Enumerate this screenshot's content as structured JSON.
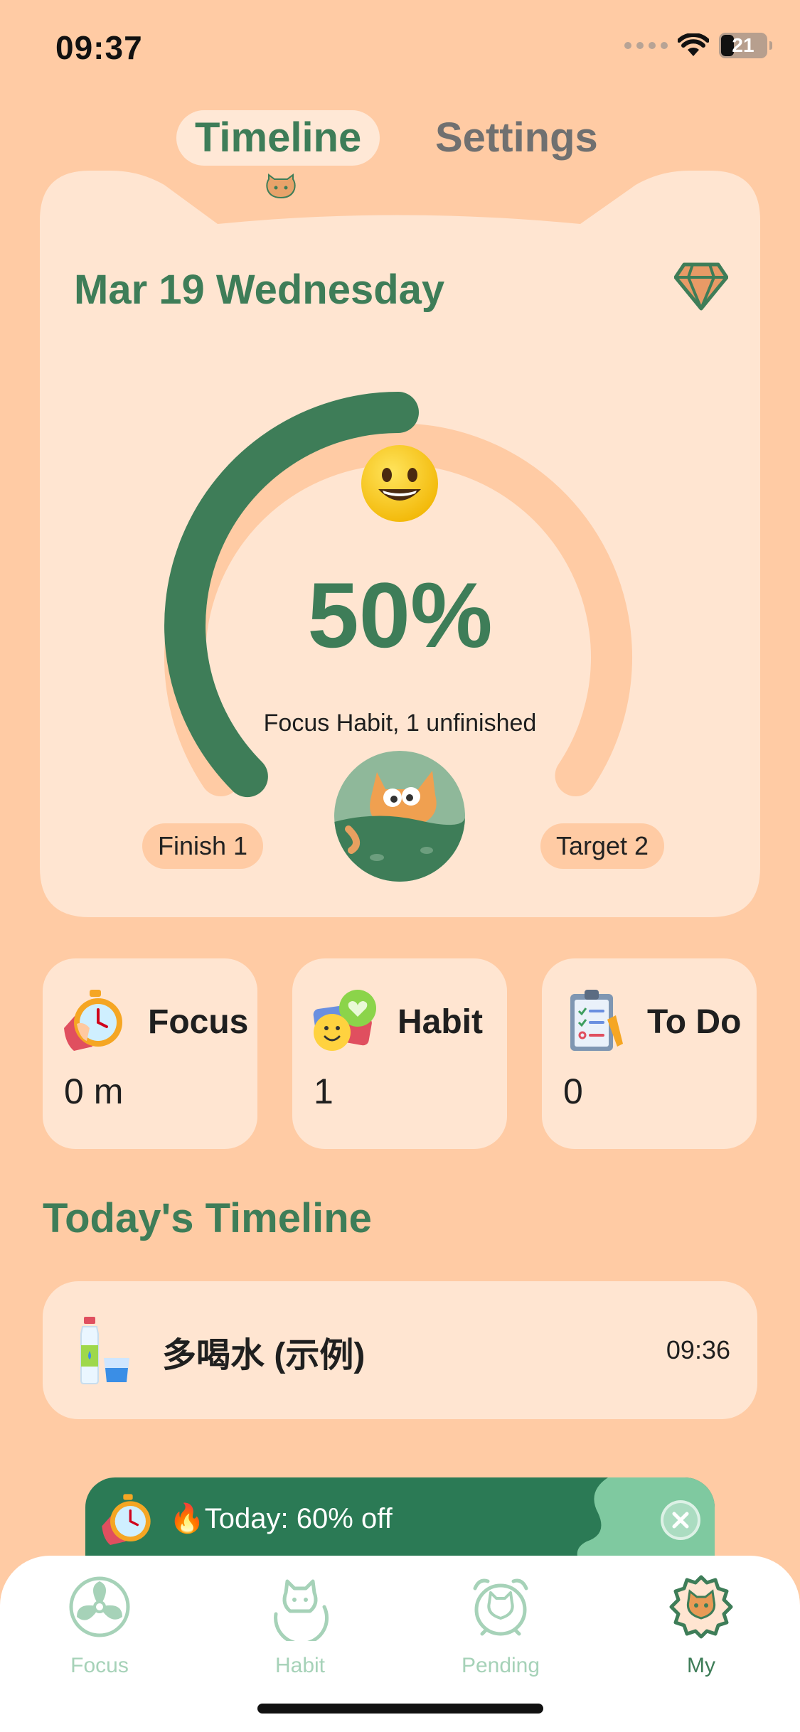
{
  "status_bar": {
    "time": "09:37",
    "battery": "21"
  },
  "tabs": [
    {
      "label": "Timeline",
      "active": true
    },
    {
      "label": "Settings",
      "active": false
    }
  ],
  "card": {
    "date": "Mar 19 Wednesday",
    "percent_text": "50%",
    "progress": 0.5,
    "subtitle": "Focus Habit, 1 unfinished",
    "finish_label": "Finish 1",
    "target_label": "Target 2"
  },
  "stats": [
    {
      "label": "Focus",
      "value": "0 m",
      "icon": "stopwatch-hand-icon"
    },
    {
      "label": "Habit",
      "value": "1",
      "icon": "smiley-heart-icon"
    },
    {
      "label": "To Do",
      "value": "0",
      "icon": "clipboard-checklist-icon"
    }
  ],
  "section_title": "Today's Timeline",
  "timeline": [
    {
      "title": "多喝水 (示例)",
      "time": "09:36",
      "icon": "water-bottle-icon"
    }
  ],
  "promo": {
    "text": "🔥Today: 60% off"
  },
  "nav": [
    {
      "label": "Focus",
      "icon": "focus-fan-icon",
      "active": false
    },
    {
      "label": "Habit",
      "icon": "habit-cat-icon",
      "active": false
    },
    {
      "label": "Pending",
      "icon": "pending-alarm-cat-icon",
      "active": false
    },
    {
      "label": "My",
      "icon": "my-cat-gear-icon",
      "active": true
    }
  ],
  "colors": {
    "background": "#FFCBA4",
    "card": "#FFE5D1",
    "accent_green": "#3E7D58",
    "arc_track": "#FFCBA4"
  }
}
